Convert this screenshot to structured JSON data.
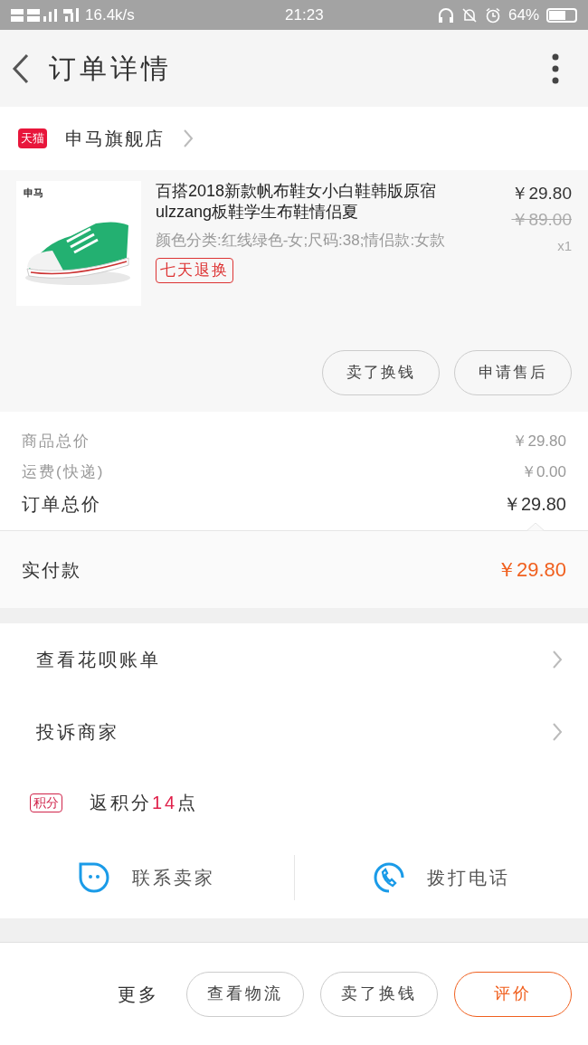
{
  "status_bar": {
    "network": "16.4k/s",
    "time": "21:23",
    "battery": "64%"
  },
  "header": {
    "title": "订单详情"
  },
  "store": {
    "badge": "天猫",
    "name": "申马旗舰店"
  },
  "product": {
    "brand_mark": "申马",
    "title": "百搭2018新款帆布鞋女小白鞋韩版原宿ulzzang板鞋学生布鞋情侣夏",
    "price": "￥29.80",
    "original_price": "￥89.00",
    "quantity": "x1",
    "specs": "颜色分类:红线绿色-女;尺码:38;情侣款:女款",
    "tag": "七天退换",
    "buttons": [
      "卖了换钱",
      "申请售后"
    ]
  },
  "summary": [
    {
      "label": "商品总价",
      "value": "￥29.80",
      "kind": "minor"
    },
    {
      "label": "运费(快递)",
      "value": "￥0.00",
      "kind": "minor"
    },
    {
      "label": "订单总价",
      "value": "￥29.80",
      "kind": "major"
    }
  ],
  "payment": {
    "label": "实付款",
    "value": "￥29.80"
  },
  "menu": [
    {
      "label": "查看花呗账单",
      "kind": "link"
    },
    {
      "label": "投诉商家",
      "kind": "link"
    },
    {
      "label": "返积分**14**点",
      "badge": "积分",
      "kind": "points"
    }
  ],
  "contact": [
    {
      "label": "联系卖家",
      "kind": "chat"
    },
    {
      "label": "拨打电话",
      "kind": "phone"
    }
  ],
  "bottom_bar": {
    "more": "更多",
    "buttons": [
      {
        "label": "查看物流",
        "primary": false
      },
      {
        "label": "卖了换钱",
        "primary": false
      },
      {
        "label": "评价",
        "primary": true
      }
    ]
  }
}
